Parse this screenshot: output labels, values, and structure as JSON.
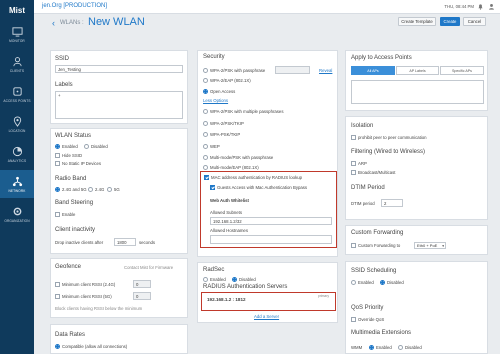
{
  "brand": "Mist",
  "nav": [
    {
      "label": "MONITOR",
      "icon": "monitor-icon"
    },
    {
      "label": "CLIENTS",
      "icon": "clients-icon"
    },
    {
      "label": "ACCESS POINTS",
      "icon": "access-points-icon"
    },
    {
      "label": "LOCATION",
      "icon": "location-icon"
    },
    {
      "label": "ANALYTICS",
      "icon": "analytics-icon"
    },
    {
      "label": "NETWORK",
      "icon": "network-icon"
    },
    {
      "label": "ORGANIZATION",
      "icon": "organization-icon"
    }
  ],
  "topbar": {
    "org": "jen.Org [PRODUCTION]",
    "clock": "THU, 08:44 PM"
  },
  "header": {
    "back": "‹",
    "breadcrumb": "WLANs :",
    "title": "New WLAN",
    "create_template": "Create Template",
    "create": "Create",
    "cancel": "Cancel"
  },
  "ssid": {
    "label": "SSID",
    "value": "Jen_Testing"
  },
  "labels": {
    "label": "Labels",
    "add": "+"
  },
  "wlan_status": {
    "label": "WLAN Status",
    "enabled": "Enabled",
    "disabled": "Disabled",
    "hide_ssid": "Hide SSID",
    "no_static_ip": "No Static IP Devices"
  },
  "radio_band": {
    "label": "Radio Band",
    "both": "2.4G and 5G",
    "g24": "2.4G",
    "g5": "5G"
  },
  "band_steering": {
    "label": "Band Steering",
    "enable": "Enable"
  },
  "client_inactivity": {
    "label": "Client inactivity",
    "prefix": "Drop inactive clients after",
    "value": "1800",
    "suffix": "seconds"
  },
  "geofence": {
    "label": "Geofence",
    "contact": "Contact Mist for Firmware",
    "min24": "Minimum client RSSI (2.4G)",
    "min24_value": "0",
    "min5": "Minimum client RSSI (5G)",
    "min5_value": "0",
    "note": "Block clients having RSSI below the minimum"
  },
  "data_rates": {
    "label": "Data Rates",
    "compatible": "Compatible (allow all connections)"
  },
  "security": {
    "label": "Security",
    "wpa2_pass": "WPA-2/PSK with passphrase",
    "reveal": "Reveal",
    "wpa2_enterprise": "WPA-2/EAP (802.1X)",
    "open": "Open Access",
    "less_options": "Less Options",
    "wpa2_multi": "WPA-2/PSK with multiple passphrases",
    "wpa2_psk_tkip": "WPA-2/PSK/TKIP",
    "wpa_psk_tkip": "WPA-PSK/TKIP",
    "wep": "WEP",
    "multi_mode_psk": "Multi-mode/PSK with passphrase",
    "multi_mode_eap": "Multi-mode/EAP (802.1X)",
    "mac_auth": "MAC address authentication by RADIUS lookup",
    "guest_access": "Guests Access with Mac Authentication Bypass",
    "whitelist": "Web Auth Whitelist",
    "allowed_subnets": "Allowed Subnets",
    "subnet_value": "192.168.1.2/32",
    "allowed_hostnames": "Allowed Hostnames"
  },
  "radsec": {
    "label": "RadSec",
    "enabled": "Enabled",
    "disabled": "Disabled"
  },
  "radius": {
    "label": "RADIUS Authentication Servers",
    "server": "192.168.1.2 : 1812",
    "tag": "primary",
    "add": "Add a Server"
  },
  "apply": {
    "label": "Apply to Access Points",
    "tabs": [
      "All APs",
      "AP Labels",
      "Specific APs"
    ]
  },
  "isolation": {
    "label": "Isolation",
    "p2p": "prohibit peer to peer communication"
  },
  "filtering": {
    "label": "Filtering (Wired to Wireless)",
    "arp": "ARP",
    "broadcast": "Broadcast/Multicast"
  },
  "dtim": {
    "label": "DTIM Period",
    "field_label": "DTIM period",
    "value": "2"
  },
  "custom_forwarding": {
    "label": "Custom Forwarding",
    "option": "Custom Forwarding to",
    "select": "Eth0 + PoE"
  },
  "ssid_scheduling": {
    "label": "SSID Scheduling",
    "enabled": "Enabled",
    "disabled": "Disabled"
  },
  "qos": {
    "label": "QoS Priority",
    "override": "Override QoS"
  },
  "multimedia": {
    "label": "Multimedia Extensions",
    "wmm": "WMM",
    "enabled": "Enabled",
    "disabled": "Disabled"
  }
}
